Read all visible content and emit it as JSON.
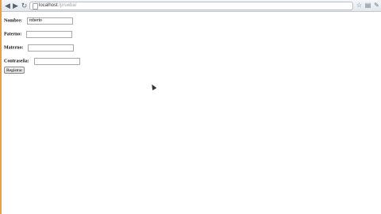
{
  "browser": {
    "url_host": "localhost",
    "url_path": ":/prueba/",
    "icons": {
      "back": "back-arrow-icon",
      "forward": "forward-arrow-icon",
      "reload": "reload-icon",
      "page": "page-icon",
      "star": "star-icon",
      "page_menu": "page-menu-icon",
      "wrench": "wrench-icon"
    }
  },
  "form": {
    "nombre": {
      "label": "Nombre:",
      "value": "roberto"
    },
    "paterno": {
      "label": "Paterno:",
      "value": ""
    },
    "materno": {
      "label": "Materno:",
      "value": ""
    },
    "contrasena": {
      "label": "Contraseña:",
      "value": ""
    },
    "submit_label": "Registrar"
  }
}
